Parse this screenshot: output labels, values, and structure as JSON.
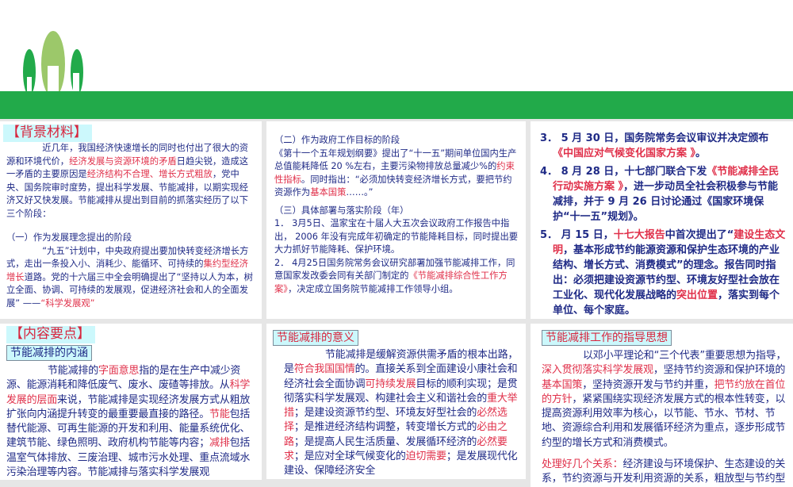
{
  "colors": {
    "band": "#22aa4a",
    "text": "#1f2a86",
    "accent": "#e0304a",
    "label_bg": "#ccf8fc"
  },
  "p1": {
    "title": "【背景材料】",
    "paras": [
      [
        [
          "近几年，我国经济快速增长的同时也付出了很大的资源和环境代价，",
          0
        ],
        [
          "经济发展与资源环境的矛盾",
          1
        ],
        [
          "日趋尖锐，造成这一矛盾的主要原因是",
          0
        ],
        [
          "经济结构不合理、增长方式粗放",
          1
        ],
        [
          "，党中央、国务院审时度势，提出科学发展、节能减排，以期实现经济又好又快发展。节能减排从提出到目前的抓落实经历了以下三个阶段：",
          0
        ]
      ],
      [
        [
          "（一）作为发展理念提出的阶段",
          0
        ]
      ],
      [
        [
          "“九五”计划中，中央政府提出要加快转变经济增长方式，走出一条投入小、消耗少、能循环、可持续的",
          0
        ],
        [
          "集约型经济增长",
          1
        ],
        [
          "道路。党的十六届三中全会明确提出了“坚持以人为本，树立全面、协调、可持续的发展观，促进经济社会和人的全面发展” ——",
          0
        ],
        [
          "“科学发展观”",
          1
        ]
      ]
    ]
  },
  "p2": {
    "paras": [
      [
        [
          "（二）作为政府工作目标的阶段",
          0
        ]
      ],
      [
        [
          "《第十一个五年规划纲要》提出了“十一五”期间单位国内生产总值能耗降低 20 %左右，主要污染物排放总量减少%的",
          0
        ],
        [
          "约束性指标",
          1
        ],
        [
          "。同时指出：“必须加快转变经济增长方式，要把节约资源作为",
          0
        ],
        [
          "基本国策",
          1
        ],
        [
          "……。”",
          0
        ]
      ],
      [
        [
          "（三）具体部署与落实阶段（年）",
          0
        ]
      ],
      [
        [
          "1． 3月5日、温家宝在十届人大五次会议政府工作报告中指出， 2006 年没有完成年初确定的节能降耗目标，同时提出要大力抓好节能降耗、保护环境。",
          0
        ]
      ],
      [
        [
          "2． 4月25日国务院常务会议研究部署加强节能减排工作，同意国家发改委会同有关部门制定的",
          0
        ],
        [
          "《节能减排综合性工作方案》",
          1
        ],
        [
          "，决定成立国务院节能减排工作领导小组。",
          0
        ]
      ]
    ]
  },
  "p3": {
    "paras": [
      [
        [
          "3． 5 月 30 日，国务院常务会议审议并决定颁布",
          0
        ],
        [
          "《中国应对气候变化国家方案 》",
          1
        ],
        [
          "。",
          0
        ]
      ],
      [
        [
          "4． 8 月 28 日，十七部门联合下发",
          0
        ],
        [
          "《节能减排全民行动实施方案 》",
          1
        ],
        [
          "，进一步动员全社会积极参与节能减排，并于 9 月 26 日讨论通过《国家环境保护“十一五”规划》。",
          0
        ]
      ],
      [
        [
          "5． 月 15 日，",
          0
        ],
        [
          "十七大报告",
          1
        ],
        [
          "中首次提出了“",
          0
        ],
        [
          "建设生态文明",
          1
        ],
        [
          "，基本形成节约能源资源和保护生态环境的产业结构、增长方式、消费模式”的理念。报告同时指出：必须把建设资源节约型、环境友好型社会放在工业化、现代化发展战略的",
          0
        ],
        [
          "突出位置",
          1
        ],
        [
          "，落实到每个单位、每个家庭。",
          0
        ]
      ]
    ]
  },
  "p4": {
    "title": "【内容要点】",
    "label": "节能减排的内涵",
    "paras": [
      [
        [
          "节能减排的",
          0
        ],
        [
          "字面意思",
          1
        ],
        [
          "指的是在生产中减少资源、能源消耗和降低废气、废水、废碴等排放。从",
          0
        ],
        [
          "科学发展的层面",
          1
        ],
        [
          "来说，节能减排是实现经济发展方式从粗放扩张向内涵提升转变的最重要最直接的路径。",
          0
        ],
        [
          "节能",
          1
        ],
        [
          "包括替代能源、可再生能源的开发和利用、能量系统优化、建筑节能、绿色照明、政府机构节能等内容；",
          0
        ],
        [
          "减排",
          1
        ],
        [
          "包括温室气体排放、三废治理、城市污水处理、重点流域水污染治理等内容。节能减排与落实科学发展观",
          0
        ]
      ]
    ]
  },
  "p5": {
    "label": "节能减排的意义",
    "paras": [
      [
        [
          "节能减排是缓解资源供需矛盾的根本出路，是",
          0
        ],
        [
          "符合我国国情",
          1
        ],
        [
          "的。直接关系到全面建设小康社会和经济社会全面协调",
          0
        ],
        [
          "可持续发展",
          1
        ],
        [
          "目标的顺利实现；是贯彻落实科学发展观、构建社会主义和谐社会的",
          0
        ],
        [
          "重大举措",
          1
        ],
        [
          "；是建设资源节约型、环境友好型社会的",
          0
        ],
        [
          "必然选择",
          1
        ],
        [
          "；是推进经济结构调整，转变增长方式的",
          0
        ],
        [
          "必由之路",
          1
        ],
        [
          "；是提高人民生活质量、发展循环经济的",
          0
        ],
        [
          "必然要求",
          1
        ],
        [
          "；是应对全球气候变化的",
          0
        ],
        [
          "迫切需要",
          1
        ],
        [
          "；是发展现代化建设、保障经济安全",
          0
        ]
      ]
    ]
  },
  "p6": {
    "label": "节能减排工作的指导思想",
    "paras": [
      [
        [
          "以邓小平理论和“三个代表”重要思想为指导，",
          0
        ],
        [
          "深入贯彻落实科学发展观",
          1
        ],
        [
          "，坚持节约资源和保护环境的",
          0
        ],
        [
          "基本国策",
          1
        ],
        [
          "，坚持资源开发与节约并重，",
          0
        ],
        [
          "把节约放在首位的方针",
          1
        ],
        [
          "，紧紧围绕实现经济发展方式的根本性转变，以提高资源利用效率为核心，以节能、节水、节材、节地、资源综合利用和发展循环经济为重点，逐步形成节约型的增长方式和消费模式。",
          0
        ]
      ],
      [
        [
          "处理好几个关系：",
          1
        ],
        [
          "经济建设与环境保护、生态建设的关系，节约资源与开发利用资源的关系，粗放型与节约型",
          0
        ]
      ]
    ]
  }
}
